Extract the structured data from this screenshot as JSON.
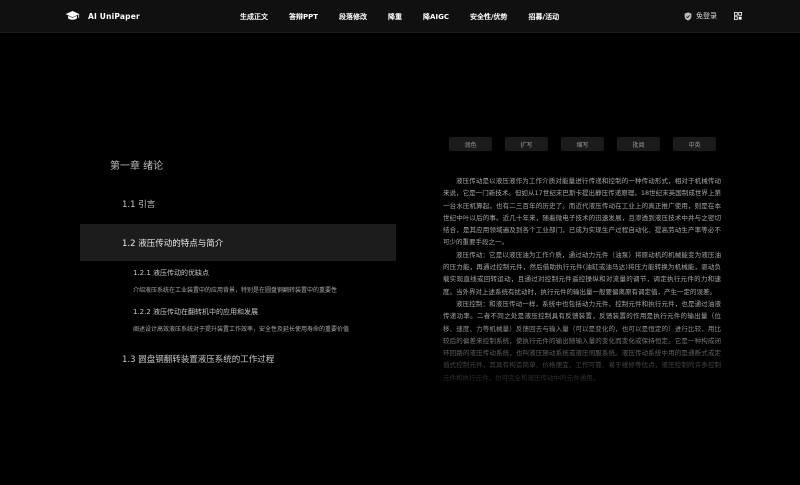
{
  "brand": {
    "name": "AI UniPaper"
  },
  "nav": {
    "items": [
      "生成正文",
      "答辩PPT",
      "段落修改",
      "降重",
      "降AIGC",
      "安全性/优势",
      "招募/活动"
    ],
    "login_label": "免登录"
  },
  "outline": {
    "chapter": "第一章 绪论",
    "section_1": "1.1 引言",
    "section_2": "1.2 液压传动的特点与简介",
    "sub_1_title": "1.2.1 液压传动的优缺点",
    "sub_1_desc": "介绍液压系统在工业装置中的应用背景，特别是在圆盘钢翻转装置中的重要性",
    "sub_2_title": "1.2.2 液压传动在翻转机中的应用和发展",
    "sub_2_desc": "阐述设计高效液压系统对于提升装置工作效率，安全性及延长使用寿命的重要价值",
    "section_3": "1.3 圆盘钢翻转装置液压系统的工作过程"
  },
  "tools": [
    "润色",
    "扩写",
    "缩写",
    "批阅",
    "中英"
  ],
  "content": {
    "paragraphs": [
      "液压传动是以液压液作为工作介质对能量进行传递和控制的一种传动形式，相对于机械传动来说，它是一门新技术。但如从17世纪末巴斯卡提出静压传递原理，18世纪末英国制成世界上第一台水压机算起，也有二三百年的历史了。而近代液压传动在工业上的真正推广使用，则是在本世纪中叶以后的事。近几十年来，随着微电子技术的迅速发展，且渗透到液压技术中并与之密切结合，是其应用领域遍及到各个工业部门，已成为实现生产过程自动化、提高劳动生产率等必不可少的重要手段之一。",
      "液压传动：它是以液压油为工作介质，通过动力元件（油泵）将原动机的机械能变为液压油的压力能，再通过控制元件，然后借助执行元件(油缸或油马达)将压力能转换为机械能，驱动负载实现直线或回转运动，且通过对控制元件遥控操纵和对流量的调节，调定执行元件的力和速度。当外界对上述系统有扰动时，执行元件的输出量一般要偏离原有调定值，产生一定的误差。",
      "液压控制：和液压传动一样，系统中也包括动力元件、控制元件和执行元件，也是通过油液传递功率。二者不同之处是液压控制具有反馈装置，反馈装置的作用是执行元件的输出量（位移、速度、力等机械量）反馈回去与输入量（可以是变化的，也可以是恒定的）进行比较，用比较后的偏差来控制系统，使执行元件的输出随输入量的变化而变化或保持恒定。它是一种构成闭环回路的液压传动系统，也叫液压随动系统或液压伺服系统。液压传动系统中用的是通断式或定值式控制元件，其具有构造简单、价格便宜、工作可靠、易于维修等优点，液压控制的许多控制元件和执行元件，也可完全和液压传动中的元件通用。"
    ]
  },
  "colors": {
    "background": "#000000",
    "navbar": "#101010",
    "active_row": "#1c1c1c",
    "tool_button": "#1b1b1b"
  }
}
